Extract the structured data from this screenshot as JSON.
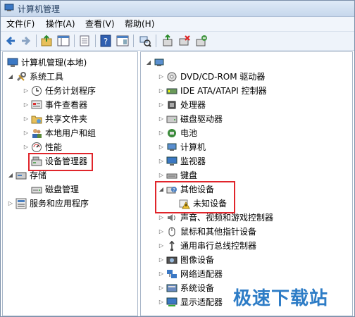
{
  "window": {
    "title": "计算机管理"
  },
  "menu": [
    "文件(F)",
    "操作(A)",
    "查看(V)",
    "帮助(H)"
  ],
  "toolbar": [
    "back-icon",
    "forward-icon",
    "up-icon",
    "show-tree-icon",
    "properties-icon",
    "help-icon",
    "console-icon",
    "scan-icon",
    "update-driver-icon",
    "disable-device-icon",
    "uninstall-icon"
  ],
  "left_tree": {
    "root": "计算机管理(本地)",
    "system_tools": "系统工具",
    "items": [
      "任务计划程序",
      "事件查看器",
      "共享文件夹",
      "本地用户和组",
      "性能",
      "设备管理器"
    ],
    "storage": "存储",
    "disk_mgmt": "磁盘管理",
    "services": "服务和应用程序"
  },
  "device_tree": {
    "devices": [
      "DVD/CD-ROM 驱动器",
      "IDE ATA/ATAPI 控制器",
      "处理器",
      "磁盘驱动器",
      "电池",
      "计算机",
      "监视器",
      "键盘"
    ],
    "other": "其他设备",
    "unknown": "未知设备",
    "devices2": [
      "声音、视频和游戏控制器",
      "鼠标和其他指针设备",
      "通用串行总线控制器",
      "图像设备",
      "网络适配器",
      "系统设备",
      "显示适配器"
    ]
  },
  "watermark": "极速下载站",
  "colors": {
    "highlight": "#e0252b",
    "watermark": "#2d7cc6"
  }
}
